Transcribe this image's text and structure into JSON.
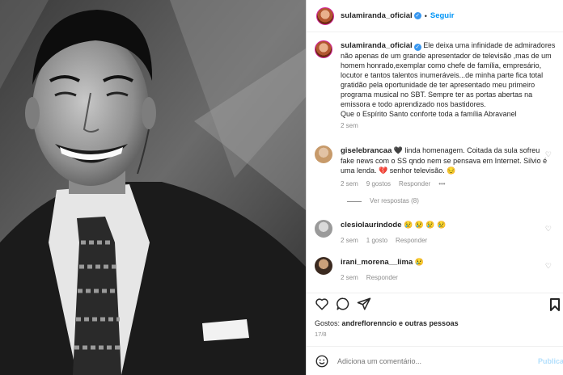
{
  "post": {
    "username": "sulamiranda_oficial",
    "follow_label": "Seguir",
    "caption_lines": [
      "Ele deixa uma infinidade de admiradores",
      "não apenas de um grande apresentador de televisão ,mas de um",
      "homem honrado,exemplar como chefe de família, empresário,",
      "locutor e tantos talentos inumeráveis...de minha parte fica total",
      "gratidão pela oportunidade de ter apresentado meu primeiro",
      "programa musical no SBT. Sempre ter as portas abertas na",
      "emissora e todo aprendizado nos bastidores.",
      "Que o Espírito Santo conforte toda a família Abravanel"
    ],
    "caption_time": "2 sem"
  },
  "comments": [
    {
      "username": "giselebrancaa",
      "lines": [
        "🖤 linda homenagem. Coitada da sula sofreu",
        "fake news com o SS qndo nem se pensava em Internet. Silvio é",
        "uma lenda. 💔 senhor televisão. 😔"
      ],
      "time": "2 sem",
      "likes": "9 gostos",
      "reply": "Responder",
      "more": "•••",
      "view_replies": "Ver respostas (8)"
    },
    {
      "username": "clesiolaurindode",
      "lines": [
        "😢 😢 😢 😢"
      ],
      "time": "2 sem",
      "likes": "1 gosto",
      "reply": "Responder"
    },
    {
      "username": "irani_morena__lima",
      "lines": [
        "😢"
      ],
      "time": "2 sem",
      "reply": "Responder"
    }
  ],
  "footer": {
    "likes_label": "Gostos:",
    "likes_names": "andreflorenncio e outras pessoas",
    "date": "17/8",
    "comment_placeholder": "Adiciona um comentário...",
    "publish_label": "Publica"
  },
  "colors": {
    "accent": "#0095f6",
    "text": "#262626",
    "muted": "#8e8e8e",
    "border": "#dbdbdb"
  }
}
